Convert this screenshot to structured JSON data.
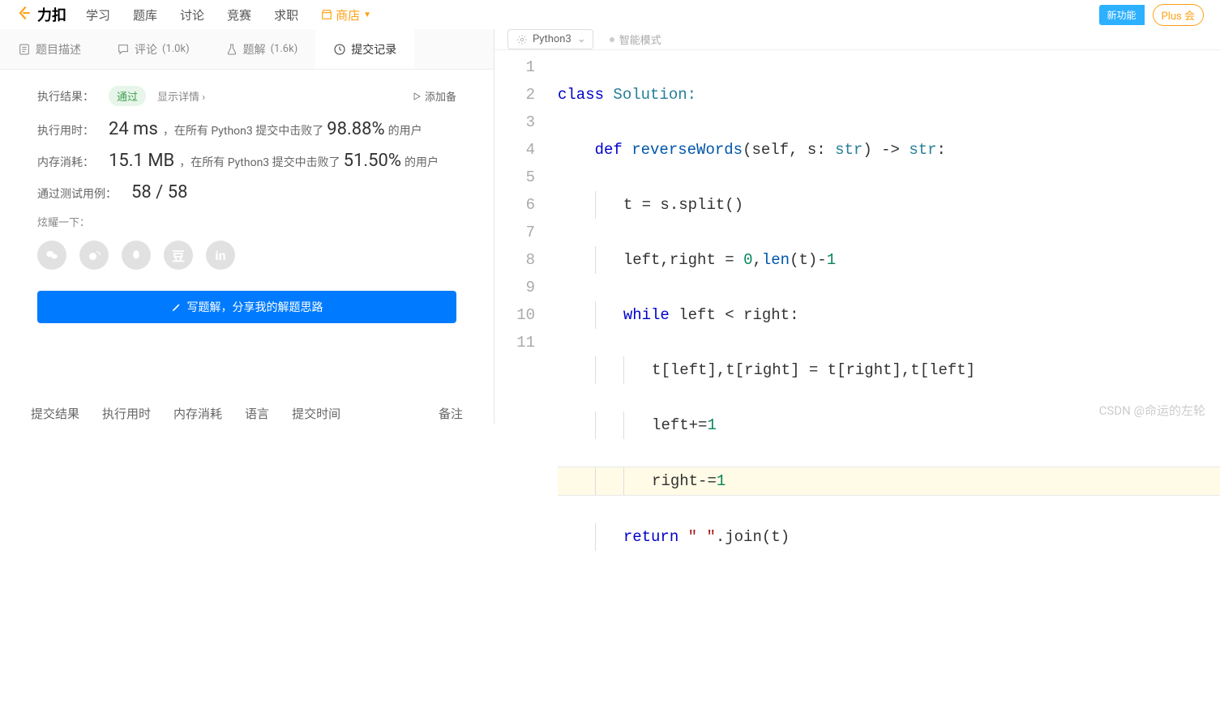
{
  "header": {
    "brand": "力扣",
    "nav": [
      "学习",
      "题库",
      "讨论",
      "竞赛",
      "求职"
    ],
    "store": "商店",
    "new_feature": "新功能",
    "plus": "Plus 会"
  },
  "tabs": {
    "desc": "题目描述",
    "comments_label": "评论",
    "comments_count": "(1.0k)",
    "solutions_label": "题解",
    "solutions_count": "(1.6k)",
    "submissions": "提交记录"
  },
  "result": {
    "result_label": "执行结果：",
    "status": "通过",
    "details": "显示详情 ›",
    "add_note": "添加备",
    "time_label": "执行用时：",
    "time_value": "24 ms",
    "time_suffix": "，在所有 Python3 提交中击败了",
    "time_pct": "98.88%",
    "time_tail": " 的用户",
    "mem_label": "内存消耗：",
    "mem_value": "15.1 MB",
    "mem_suffix": "，在所有 Python3 提交中击败了",
    "mem_pct": "51.50%",
    "mem_tail": " 的用户",
    "cases_label": "通过测试用例：",
    "cases_value": "58 / 58",
    "share_label": "炫耀一下：",
    "write_btn": "写题解，分享我的解题思路"
  },
  "bottom_tabs": [
    "提交结果",
    "执行用时",
    "内存消耗",
    "语言",
    "提交时间",
    "备注"
  ],
  "editor": {
    "language": "Python3",
    "smart_mode": "智能模式",
    "lines": [
      "1",
      "2",
      "3",
      "4",
      "5",
      "6",
      "7",
      "8",
      "9",
      "10",
      "11"
    ]
  },
  "code": {
    "l1": {
      "a": "class",
      "b": " Solution:"
    },
    "l2": {
      "a": "def",
      "b": " reverseWords",
      "c": "(self, s: ",
      "d": "str",
      "e": ") -> ",
      "f": "str",
      "g": ":"
    },
    "l3": "t = s.split()",
    "l4": {
      "a": "left,right = ",
      "b": "0",
      "c": ",",
      "d": "len",
      "e": "(t)-",
      "f": "1"
    },
    "l5": {
      "a": "while",
      "b": " left < right:"
    },
    "l6": "t[left],t[right] = t[right],t[left]",
    "l7": {
      "a": "left+=",
      "b": "1"
    },
    "l8": {
      "a": "right-=",
      "b": "1"
    },
    "l9": {
      "a": "return",
      "b": " ",
      "c": "\" \"",
      "d": ".join(t)"
    }
  },
  "watermark": "CSDN @命运的左轮"
}
